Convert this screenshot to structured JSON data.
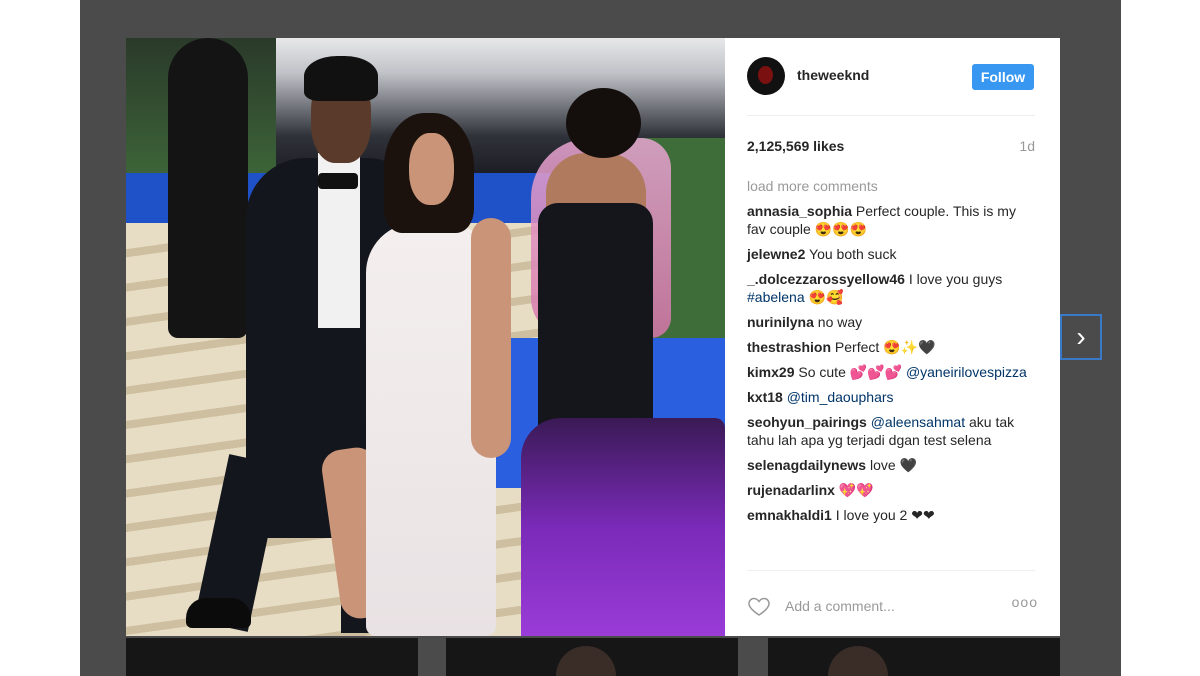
{
  "post": {
    "username": "theweeknd",
    "follow_label": "Follow",
    "likes": "2,125,569 likes",
    "age": "1d",
    "load_more": "load more comments",
    "add_comment_placeholder": "Add a comment...",
    "more_options": "ooo"
  },
  "comments": [
    {
      "user": "annasia_sophia",
      "text": " Perfect couple. This is my fav couple 😍😍😍"
    },
    {
      "user": "jelewne2",
      "text": " You both suck"
    },
    {
      "user": "_.dolcezzarossyellow46",
      "text": " I love you guys ",
      "mention": "#abelena",
      "after": " 😍🥰"
    },
    {
      "user": "nurinilyna",
      "text": " no way"
    },
    {
      "user": "thestrashion",
      "text": " Perfect 😍✨🖤"
    },
    {
      "user": "kimx29",
      "text": " So cute 💕💕💕 ",
      "mention": "@yaneirilovespizza",
      "after": ""
    },
    {
      "user": "kxt18",
      "text": " ",
      "mention": "@tim_daouphars",
      "after": ""
    },
    {
      "user": "seohyun_pairings",
      "text": " ",
      "mention": "@aleensahmat",
      "after": " aku tak tahu lah apa yg terjadi dgan test selena"
    },
    {
      "user": "selenagdailynews",
      "text": " love 🖤"
    },
    {
      "user": "rujenadarlinx",
      "text": " 💖💖"
    },
    {
      "user": "emnakhaldi1",
      "text": " I love you 2 ❤❤"
    }
  ],
  "nav": {
    "next_glyph": "›"
  },
  "icons": {
    "heart": "heart-icon",
    "next": "chevron-right-icon"
  },
  "colors": {
    "follow": "#3897f0",
    "overlay": "#4b4b4b",
    "mention": "#003569"
  }
}
